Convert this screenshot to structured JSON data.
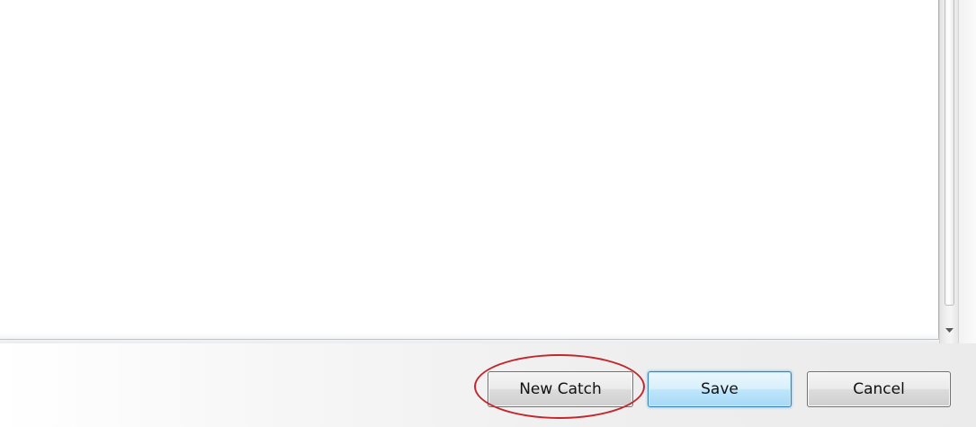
{
  "dialog": {
    "buttons": {
      "new_catch_label": "New Catch",
      "save_label": "Save",
      "cancel_label": "Cancel"
    },
    "default_button": "Save",
    "highlighted_button": "New Catch",
    "highlight_color": "#c2272d"
  }
}
